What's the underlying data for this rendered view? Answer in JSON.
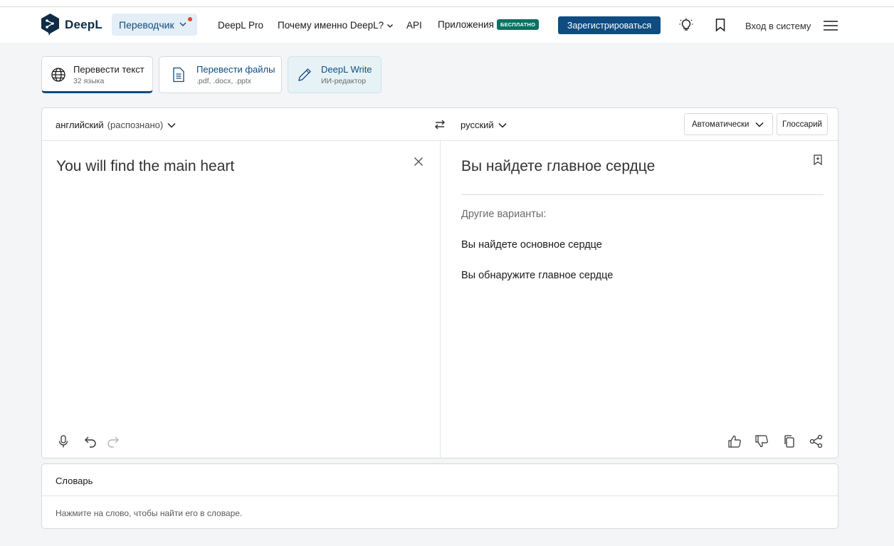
{
  "header": {
    "logo_text": "DeepL",
    "translator_label": "Переводчик",
    "nav": {
      "pro": "DeepL Pro",
      "why": "Почему именно DeepL?",
      "api": "API",
      "apps": "Приложения",
      "apps_badge": "БЕСПЛАТНО"
    },
    "signup_label": "Зарегистрироваться",
    "login_label": "Вход в систему"
  },
  "mode_tabs": [
    {
      "title": "Перевести текст",
      "subtitle": "32 языка"
    },
    {
      "title": "Перевести файлы",
      "subtitle": ".pdf, .docx, .pptx"
    },
    {
      "title": "DeepL Write",
      "subtitle": "ИИ-редактор"
    }
  ],
  "translator": {
    "source_lang": "английский",
    "source_detected": "(распознано)",
    "target_lang": "русский",
    "formality_label": "Автоматически",
    "glossary_label": "Глоссарий",
    "source_text": "You will find the main heart",
    "target_text": "Вы найдете главное сердце",
    "alternatives_title": "Другие варианты:",
    "alternatives": [
      "Вы найдете основное сердце",
      "Вы обнаружите главное сердце"
    ]
  },
  "dictionary": {
    "title": "Словарь",
    "hint": "Нажмите на слово, чтобы найти его в словаре."
  },
  "colors": {
    "brand": "#0f2b46",
    "accent": "#0f4c81",
    "badge": "#0c7063",
    "notification": "#e2452f"
  }
}
